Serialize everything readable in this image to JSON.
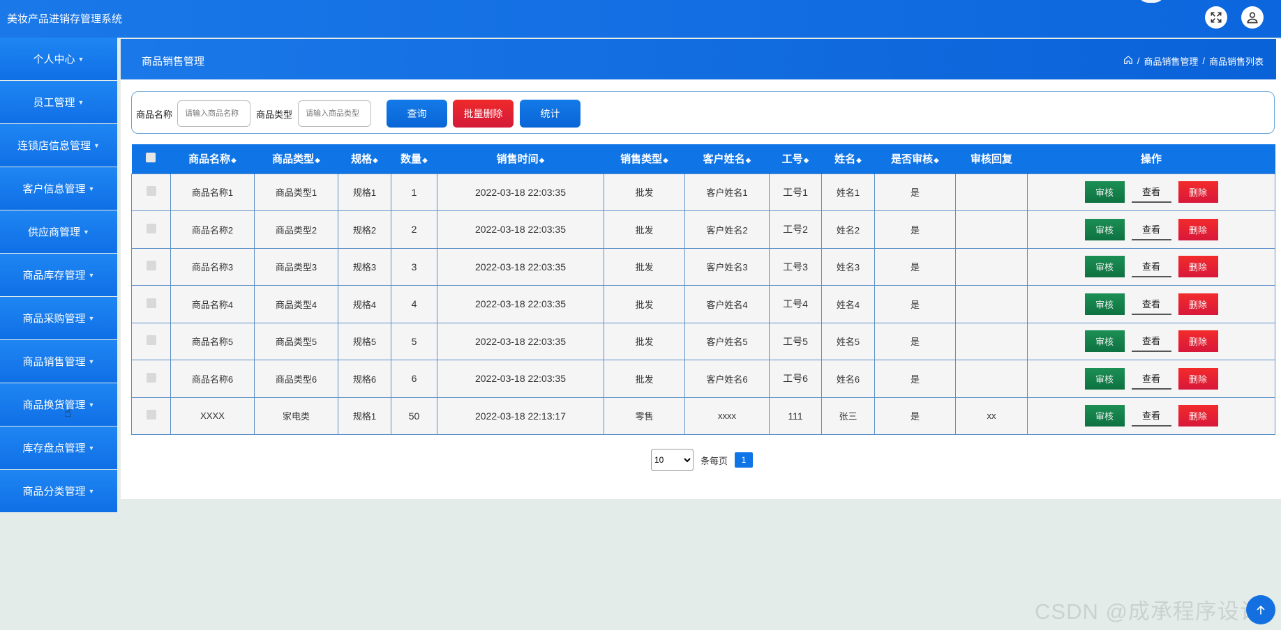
{
  "app": {
    "title": "美妆产品进销存管理系统"
  },
  "topbar": {
    "fullscreen_icon": "fullscreen-icon",
    "user_icon": "user-icon"
  },
  "sidebar": {
    "items": [
      {
        "label": "个人中心"
      },
      {
        "label": "员工管理"
      },
      {
        "label": "连锁店信息管理"
      },
      {
        "label": "客户信息管理"
      },
      {
        "label": "供应商管理"
      },
      {
        "label": "商品库存管理"
      },
      {
        "label": "商品采购管理"
      },
      {
        "label": "商品销售管理"
      },
      {
        "label": "商品换货管理"
      },
      {
        "label": "库存盘点管理"
      },
      {
        "label": "商品分类管理"
      }
    ]
  },
  "page": {
    "title": "商品销售管理",
    "breadcrumb": {
      "home_icon": "home-icon",
      "sep": "/",
      "level1": "商品销售管理",
      "level2": "商品销售列表"
    }
  },
  "search": {
    "name_label": "商品名称",
    "name_placeholder": "请输入商品名称",
    "type_label": "商品类型",
    "type_placeholder": "请输入商品类型",
    "query_btn": "查询",
    "batch_delete_btn": "批量删除",
    "stats_btn": "统计"
  },
  "table": {
    "headers": [
      "商品名称",
      "商品类型",
      "规格",
      "数量",
      "销售时间",
      "销售类型",
      "客户姓名",
      "工号",
      "姓名",
      "是否审核",
      "审核回复",
      "操作"
    ],
    "sort_glyph": "◆",
    "rows": [
      [
        "商品名称1",
        "商品类型1",
        "规格1",
        "1",
        "2022-03-18 22:03:35",
        "批发",
        "客户姓名1",
        "工号1",
        "姓名1",
        "是",
        ""
      ],
      [
        "商品名称2",
        "商品类型2",
        "规格2",
        "2",
        "2022-03-18 22:03:35",
        "批发",
        "客户姓名2",
        "工号2",
        "姓名2",
        "是",
        ""
      ],
      [
        "商品名称3",
        "商品类型3",
        "规格3",
        "3",
        "2022-03-18 22:03:35",
        "批发",
        "客户姓名3",
        "工号3",
        "姓名3",
        "是",
        ""
      ],
      [
        "商品名称4",
        "商品类型4",
        "规格4",
        "4",
        "2022-03-18 22:03:35",
        "批发",
        "客户姓名4",
        "工号4",
        "姓名4",
        "是",
        ""
      ],
      [
        "商品名称5",
        "商品类型5",
        "规格5",
        "5",
        "2022-03-18 22:03:35",
        "批发",
        "客户姓名5",
        "工号5",
        "姓名5",
        "是",
        ""
      ],
      [
        "商品名称6",
        "商品类型6",
        "规格6",
        "6",
        "2022-03-18 22:03:35",
        "批发",
        "客户姓名6",
        "工号6",
        "姓名6",
        "是",
        ""
      ],
      [
        "XXXX",
        "家电类",
        "规格1",
        "50",
        "2022-03-18 22:13:17",
        "零售",
        "xxxx",
        "111",
        "张三",
        "是",
        "xx"
      ]
    ],
    "actions": {
      "audit": "审核",
      "view": "查看",
      "delete": "删除"
    }
  },
  "pagination": {
    "page_size": "10",
    "page_size_options": [
      "10"
    ],
    "per_page_label": "条每页",
    "current_page": "1"
  },
  "watermark": "CSDN @成承程序设计",
  "colors": {
    "primary": "#0f74e6",
    "danger": "#e0202e",
    "success": "#137a46"
  }
}
